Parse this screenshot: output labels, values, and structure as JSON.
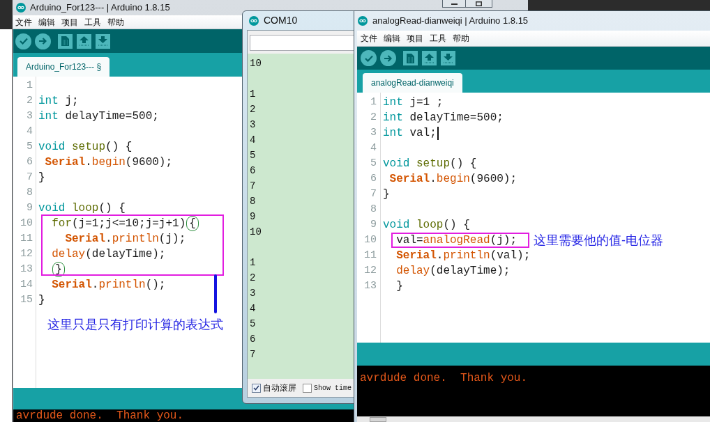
{
  "back_window": {
    "title": "Arduino_For123--- | Arduino 1.8.15",
    "menu": [
      "文件",
      "编辑",
      "项目",
      "工具",
      "帮助"
    ],
    "tabs": [
      {
        "label": "Arduino_For123--- §",
        "selected": true
      }
    ],
    "sections": [
      {
        "boxed": false,
        "lines": [
          {
            "number": "1"
          },
          {
            "number": "2",
            "tokens": [
              {
                "kind": "type",
                "text": "int"
              },
              {
                "kind": "plain",
                "text": " j;"
              }
            ]
          },
          {
            "number": "3",
            "tokens": [
              {
                "kind": "type",
                "text": "int"
              },
              {
                "kind": "plain",
                "text": " delayTime=500;"
              }
            ]
          },
          {
            "number": "4"
          },
          {
            "number": "5",
            "tokens": [
              {
                "kind": "type",
                "text": "void "
              },
              {
                "kind": "function",
                "text": "setup"
              },
              {
                "kind": "plain",
                "text": "() {"
              }
            ]
          },
          {
            "number": "6",
            "tokens": [
              {
                "kind": "class",
                "text": " Serial"
              },
              {
                "kind": "plain",
                "text": "."
              },
              {
                "kind": "method",
                "text": "begin"
              },
              {
                "kind": "plain",
                "text": "(9600);"
              }
            ]
          },
          {
            "number": "7",
            "tokens": [
              {
                "kind": "plain",
                "text": "}"
              }
            ]
          },
          {
            "number": "8"
          },
          {
            "number": "9",
            "tokens": [
              {
                "kind": "type",
                "text": "void "
              },
              {
                "kind": "function",
                "text": "loop"
              },
              {
                "kind": "plain",
                "text": "() {"
              }
            ]
          }
        ]
      },
      {
        "boxed": true,
        "lines": [
          {
            "number": "10",
            "tokens": [
              {
                "kind": "function",
                "text": "  for"
              },
              {
                "kind": "plain",
                "text": "(j=1;j<=10;j=j+1)"
              },
              {
                "kind": "circled",
                "text": "{"
              }
            ]
          },
          {
            "number": "11",
            "tokens": [
              {
                "kind": "class",
                "text": "    Serial"
              },
              {
                "kind": "plain",
                "text": "."
              },
              {
                "kind": "method",
                "text": "println"
              },
              {
                "kind": "plain",
                "text": "(j);"
              }
            ]
          },
          {
            "number": "12",
            "tokens": [
              {
                "kind": "method",
                "text": "  delay"
              },
              {
                "kind": "plain",
                "text": "(delayTime);"
              }
            ]
          },
          {
            "number": "13",
            "tokens": [
              {
                "kind": "circled",
                "text": "  }"
              }
            ]
          }
        ]
      },
      {
        "boxed": false,
        "lines": [
          {
            "number": "14",
            "tokens": [
              {
                "kind": "class",
                "text": "  Serial"
              },
              {
                "kind": "plain",
                "text": "."
              },
              {
                "kind": "method",
                "text": "println"
              },
              {
                "kind": "plain",
                "text": "();"
              }
            ]
          },
          {
            "number": "15",
            "tokens": [
              {
                "kind": "plain",
                "text": "}"
              }
            ]
          }
        ]
      }
    ],
    "note": "这里只是只有打印计算的表达式",
    "console": [
      "avrdude done.  Thank you."
    ]
  },
  "serial_monitor": {
    "title": "COM10",
    "output_blocks": [
      [
        "10"
      ],
      [
        "1",
        "2",
        "3",
        "4",
        "5",
        "6",
        "7",
        "8",
        "9",
        "10"
      ],
      [
        "1",
        "2",
        "3",
        "4",
        "5",
        "6",
        "7"
      ]
    ],
    "options": [
      {
        "label": "自动滚屏",
        "checked": true
      },
      {
        "label": "Show time",
        "checked": false
      }
    ]
  },
  "front_window": {
    "title": "analogRead-dianweiqi | Arduino 1.8.15",
    "menu": [
      "文件",
      "编辑",
      "项目",
      "工具",
      "帮助"
    ],
    "tabs": [
      {
        "label": "analogRead-dianweiqi",
        "selected": true
      }
    ],
    "sections": [
      {
        "boxed": false,
        "lines": [
          {
            "number": "1",
            "tokens": [
              {
                "kind": "type",
                "text": "int"
              },
              {
                "kind": "plain",
                "text": " j=1 ;"
              }
            ]
          },
          {
            "number": "2",
            "tokens": [
              {
                "kind": "type",
                "text": "int"
              },
              {
                "kind": "plain",
                "text": " delayTime=500;"
              }
            ]
          },
          {
            "number": "3",
            "tokens": [
              {
                "kind": "type",
                "text": "int"
              },
              {
                "kind": "plain",
                "text": " val;"
              },
              {
                "kind": "caret"
              }
            ]
          },
          {
            "number": "4"
          },
          {
            "number": "5",
            "tokens": [
              {
                "kind": "type",
                "text": "void "
              },
              {
                "kind": "function",
                "text": "setup"
              },
              {
                "kind": "plain",
                "text": "() {"
              }
            ]
          },
          {
            "number": "6",
            "tokens": [
              {
                "kind": "class",
                "text": " Serial"
              },
              {
                "kind": "plain",
                "text": "."
              },
              {
                "kind": "method",
                "text": "begin"
              },
              {
                "kind": "plain",
                "text": "(9600);"
              }
            ]
          },
          {
            "number": "7",
            "tokens": [
              {
                "kind": "plain",
                "text": "}"
              }
            ]
          },
          {
            "number": "8"
          },
          {
            "number": "9",
            "tokens": [
              {
                "kind": "type",
                "text": "void "
              },
              {
                "kind": "function",
                "text": "loop"
              },
              {
                "kind": "plain",
                "text": "() {"
              }
            ]
          }
        ]
      },
      {
        "boxed": true,
        "note": "这里需要他的值-电位器",
        "lines": [
          {
            "number": "10",
            "tokens": [
              {
                "kind": "plain",
                "text": "  val="
              },
              {
                "kind": "method",
                "text": "analogRead"
              },
              {
                "kind": "plain",
                "text": "(j);"
              }
            ]
          }
        ]
      },
      {
        "boxed": false,
        "lines": [
          {
            "number": "11",
            "tokens": [
              {
                "kind": "class",
                "text": "  Serial"
              },
              {
                "kind": "plain",
                "text": "."
              },
              {
                "kind": "method",
                "text": "println"
              },
              {
                "kind": "plain",
                "text": "(val);"
              }
            ]
          },
          {
            "number": "12",
            "tokens": [
              {
                "kind": "method",
                "text": "  delay"
              },
              {
                "kind": "plain",
                "text": "(delayTime);"
              }
            ]
          },
          {
            "number": "13",
            "tokens": [
              {
                "kind": "plain",
                "text": "  }"
              }
            ]
          }
        ]
      }
    ],
    "console": [
      "avrdude done.  Thank you."
    ]
  }
}
